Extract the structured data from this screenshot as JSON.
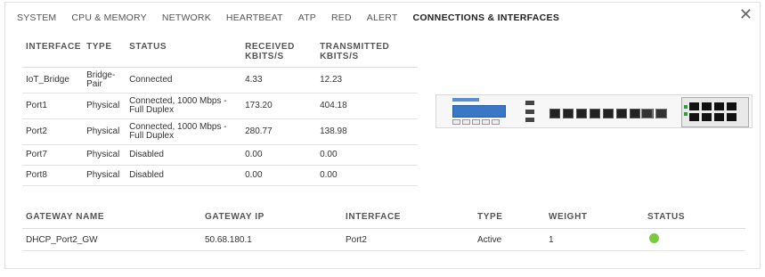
{
  "tabs": [
    {
      "label": "SYSTEM",
      "active": false
    },
    {
      "label": "CPU & MEMORY",
      "active": false
    },
    {
      "label": "NETWORK",
      "active": false
    },
    {
      "label": "HEARTBEAT",
      "active": false
    },
    {
      "label": "ATP",
      "active": false
    },
    {
      "label": "RED",
      "active": false
    },
    {
      "label": "ALERT",
      "active": false
    },
    {
      "label": "CONNECTIONS & INTERFACES",
      "active": true
    }
  ],
  "close_icon": "close-icon",
  "interfaces": {
    "headers": [
      "INTERFACE",
      "TYPE",
      "STATUS",
      "RECEIVED KBITS/S",
      "TRANSMITTED KBITS/S"
    ],
    "rows": [
      {
        "interface": "IoT_Bridge",
        "type": "Bridge-Pair",
        "status": "Connected",
        "received": "4.33",
        "transmitted": "12.23"
      },
      {
        "interface": "Port1",
        "type": "Physical",
        "status": "Connected, 1000 Mbps - Full Duplex",
        "received": "173.20",
        "transmitted": "404.18"
      },
      {
        "interface": "Port2",
        "type": "Physical",
        "status": "Connected, 1000 Mbps - Full Duplex",
        "received": "280.77",
        "transmitted": "138.98"
      },
      {
        "interface": "Port7",
        "type": "Physical",
        "status": "Disabled",
        "received": "0.00",
        "transmitted": "0.00"
      },
      {
        "interface": "Port8",
        "type": "Physical",
        "status": "Disabled",
        "received": "0.00",
        "transmitted": "0.00"
      }
    ]
  },
  "gateways": {
    "headers": [
      "GATEWAY NAME",
      "GATEWAY IP",
      "INTERFACE",
      "TYPE",
      "WEIGHT",
      "STATUS"
    ],
    "rows": [
      {
        "name": "DHCP_Port2_GW",
        "ip": "50.68.180.1",
        "interface": "Port2",
        "type": "Active",
        "weight": "1",
        "status_color": "#7ac943"
      }
    ]
  }
}
